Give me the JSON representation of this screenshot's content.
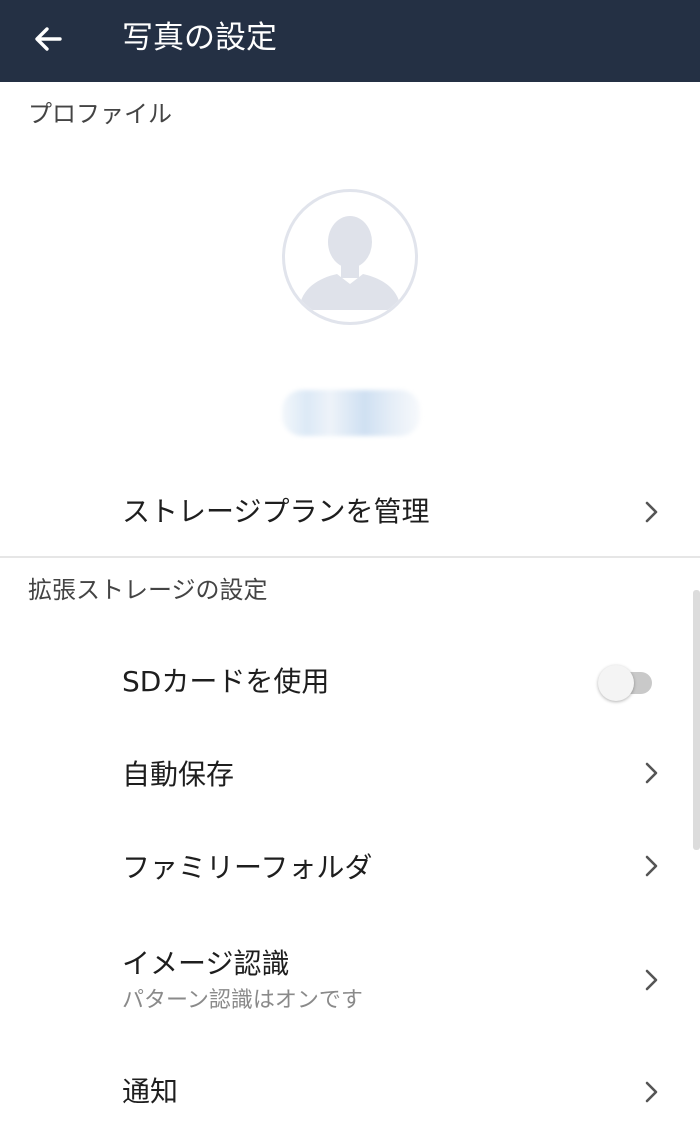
{
  "appbar": {
    "title": "写真の設定",
    "back_icon": "arrow-left-icon",
    "background": "#243044"
  },
  "profile_section": {
    "header": "プロファイル",
    "avatar_icon": "person-silhouette-icon",
    "manage_storage_label": "ストレージプランを管理"
  },
  "storage_section": {
    "header": "拡張ストレージの設定",
    "items": [
      {
        "label": "SDカードを使用",
        "control": "toggle",
        "toggle_on": false
      },
      {
        "label": "自動保存",
        "control": "chevron"
      },
      {
        "label": "ファミリーフォルダ",
        "control": "chevron"
      },
      {
        "label": "イメージ認識",
        "sub": "パターン認識はオンです",
        "control": "chevron"
      },
      {
        "label": "通知",
        "control": "chevron"
      }
    ]
  },
  "colors": {
    "appbar": "#243044",
    "text_primary": "#1e1e1e",
    "text_secondary": "#8a8a8a",
    "divider": "#e6e6e6"
  }
}
